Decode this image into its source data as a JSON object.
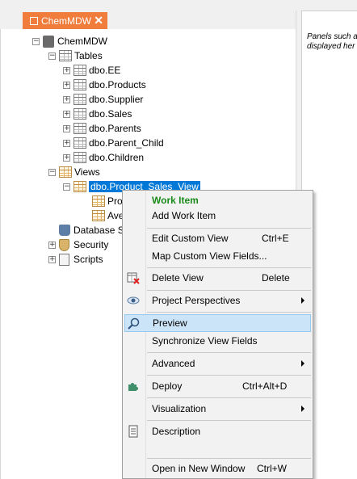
{
  "tab": {
    "title": "ChemMDW",
    "close": "✕"
  },
  "right_panel": {
    "line1": "Panels such a",
    "line2": "displayed her"
  },
  "tree": {
    "root": "ChemMDW",
    "tables_label": "Tables",
    "tables": [
      "dbo.EE",
      "dbo.Products",
      "dbo.Supplier",
      "dbo.Sales",
      "dbo.Parents",
      "dbo.Parent_Child",
      "dbo.Children"
    ],
    "views_label": "Views",
    "view": "dbo.Product_Sales_View",
    "view_children": [
      "Prod",
      "Ave"
    ],
    "database": "Database S",
    "security": "Security",
    "scripts": "Scripts",
    "expand_plus": "+",
    "expand_minus": "−"
  },
  "context_menu": {
    "work_item": "Work Item",
    "add_work_item": "Add Work Item",
    "edit_custom_view": {
      "label": "Edit Custom View",
      "shortcut": "Ctrl+E"
    },
    "map_fields": "Map Custom View Fields...",
    "delete_view": {
      "label": "Delete View",
      "shortcut": "Delete"
    },
    "project_perspectives": "Project Perspectives",
    "preview": "Preview",
    "sync_fields": "Synchronize View Fields",
    "advanced": "Advanced",
    "deploy": {
      "label": "Deploy",
      "shortcut": "Ctrl+Alt+D"
    },
    "visualization": "Visualization",
    "description": "Description",
    "open_new_window": {
      "label": "Open in New Window",
      "shortcut": "Ctrl+W"
    }
  },
  "colors": {
    "tab": "#f07d3c",
    "selection": "#0078d7",
    "highlight": "#cce4f7",
    "work_item": "#1a8a1a"
  }
}
